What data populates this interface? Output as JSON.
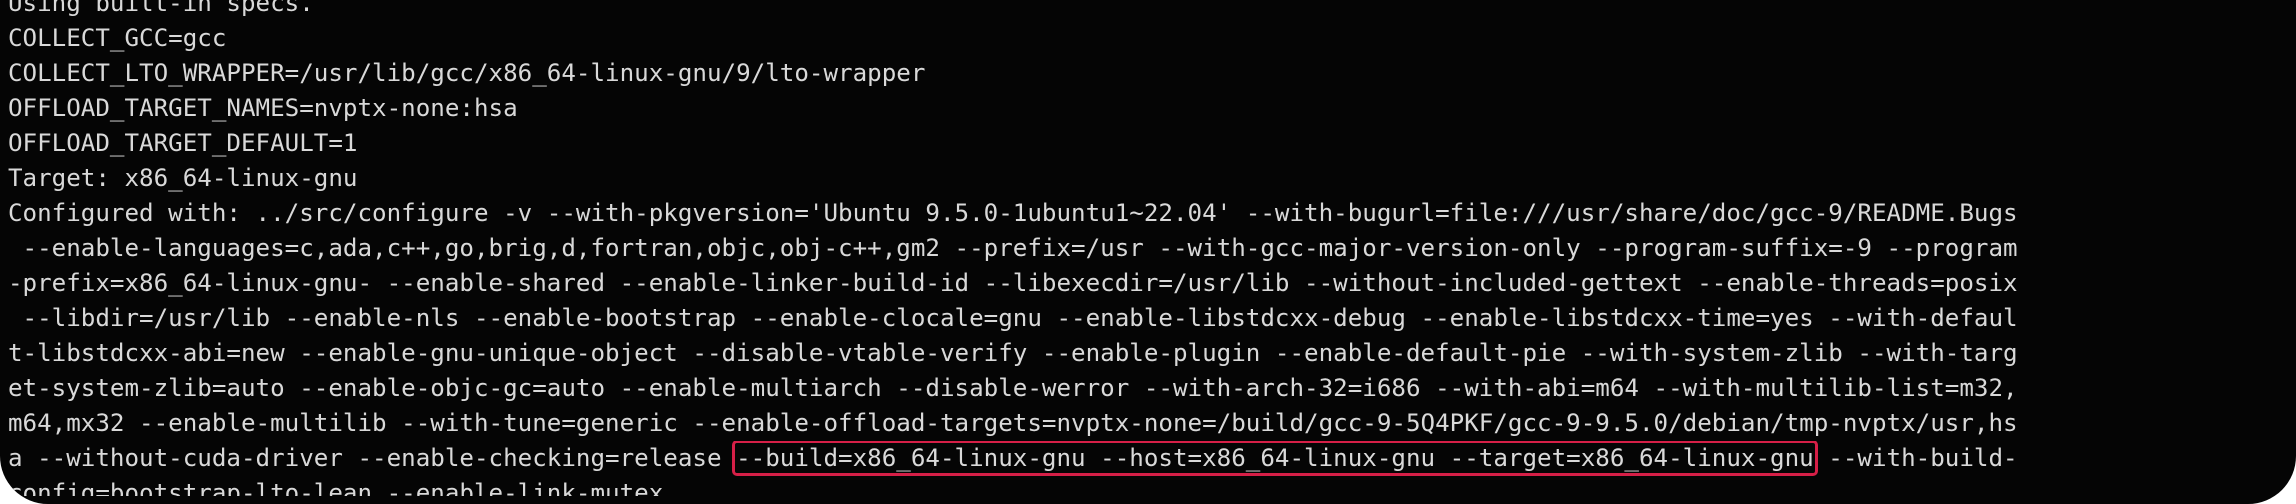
{
  "terminal": {
    "background": "#050505",
    "text_color": "#d9d9d9",
    "highlight_color": "#d61f47"
  },
  "lines": [
    "Using built-in specs.",
    "COLLECT_GCC=gcc",
    "COLLECT_LTO_WRAPPER=/usr/lib/gcc/x86_64-linux-gnu/9/lto-wrapper",
    "OFFLOAD_TARGET_NAMES=nvptx-none:hsa",
    "OFFLOAD_TARGET_DEFAULT=1",
    "Target: x86_64-linux-gnu",
    "Configured with: ../src/configure -v --with-pkgversion='Ubuntu 9.5.0-1ubuntu1~22.04' --with-bugurl=file:///usr/share/doc/gcc-9/README.Bugs",
    " --enable-languages=c,ada,c++,go,brig,d,fortran,objc,obj-c++,gm2 --prefix=/usr --with-gcc-major-version-only --program-suffix=-9 --program",
    "-prefix=x86_64-linux-gnu- --enable-shared --enable-linker-build-id --libexecdir=/usr/lib --without-included-gettext --enable-threads=posix",
    " --libdir=/usr/lib --enable-nls --enable-bootstrap --enable-clocale=gnu --enable-libstdcxx-debug --enable-libstdcxx-time=yes --with-defaul",
    "t-libstdcxx-abi=new --enable-gnu-unique-object --disable-vtable-verify --enable-plugin --enable-default-pie --with-system-zlib --with-targ",
    "et-system-zlib=auto --enable-objc-gc=auto --enable-multiarch --disable-werror --with-arch-32=i686 --with-abi=m64 --with-multilib-list=m32,",
    "m64,mx32 --enable-multilib --with-tune=generic --enable-offload-targets=nvptx-none=/build/gcc-9-5Q4PKF/gcc-9-9.5.0/debian/tmp-nvptx/usr,hs"
  ],
  "highlight_line": {
    "before": "a --without-cuda-driver --enable-checking=release ",
    "highlighted": "--build=x86_64-linux-gnu --host=x86_64-linux-gnu --target=x86_64-linux-gnu",
    "after": " --with-build-"
  },
  "cut_line": "config=bootstrap-lto-lean --enable-link-mutex"
}
